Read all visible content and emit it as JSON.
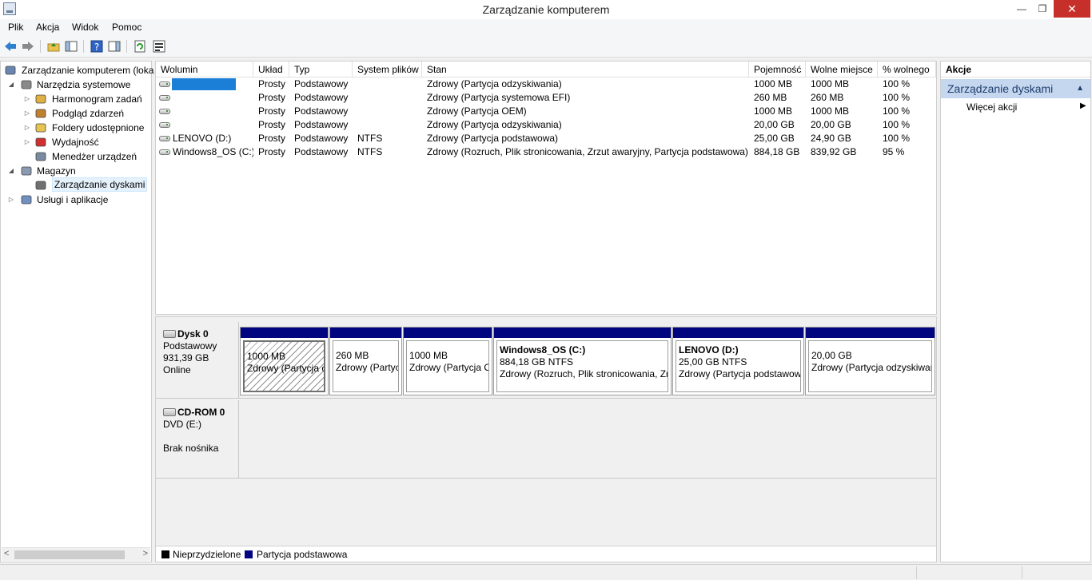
{
  "window": {
    "title": "Zarządzanie komputerem",
    "min": "—",
    "max": "❐",
    "close": "✕"
  },
  "menu": [
    "Plik",
    "Akcja",
    "Widok",
    "Pomoc"
  ],
  "tree": [
    {
      "label": "Zarządzanie komputerem (loka",
      "level": 0,
      "arrow": "",
      "icon": "computer-management-icon"
    },
    {
      "label": "Narzędzia systemowe",
      "level": 1,
      "arrow": "◢",
      "icon": "system-tools-icon"
    },
    {
      "label": "Harmonogram zadań",
      "level": 2,
      "arrow": "▷",
      "icon": "task-scheduler-icon"
    },
    {
      "label": "Podgląd zdarzeń",
      "level": 2,
      "arrow": "▷",
      "icon": "event-viewer-icon"
    },
    {
      "label": "Foldery udostępnione",
      "level": 2,
      "arrow": "▷",
      "icon": "shared-folders-icon"
    },
    {
      "label": "Wydajność",
      "level": 2,
      "arrow": "▷",
      "icon": "performance-icon"
    },
    {
      "label": "Menedżer urządzeń",
      "level": 2,
      "arrow": "",
      "icon": "device-manager-icon"
    },
    {
      "label": "Magazyn",
      "level": 1,
      "arrow": "◢",
      "icon": "storage-icon"
    },
    {
      "label": "Zarządzanie dyskami",
      "level": 2,
      "arrow": "",
      "icon": "disk-management-icon",
      "selected": true
    },
    {
      "label": "Usługi i aplikacje",
      "level": 1,
      "arrow": "▷",
      "icon": "services-apps-icon"
    }
  ],
  "volumes": {
    "headers": [
      "Wolumin",
      "Układ",
      "Typ",
      "System plików",
      "Stan",
      "Pojemność",
      "Wolne miejsce",
      "% wolnego"
    ],
    "rows": [
      {
        "name": "",
        "layout": "Prosty",
        "type": "Podstawowy",
        "fs": "",
        "status": "Zdrowy (Partycja odzyskiwania)",
        "capacity": "1000 MB",
        "free": "1000 MB",
        "pct": "100 %",
        "selected": true
      },
      {
        "name": "",
        "layout": "Prosty",
        "type": "Podstawowy",
        "fs": "",
        "status": "Zdrowy (Partycja systemowa EFI)",
        "capacity": "260 MB",
        "free": "260 MB",
        "pct": "100 %"
      },
      {
        "name": "",
        "layout": "Prosty",
        "type": "Podstawowy",
        "fs": "",
        "status": "Zdrowy (Partycja OEM)",
        "capacity": "1000 MB",
        "free": "1000 MB",
        "pct": "100 %"
      },
      {
        "name": "",
        "layout": "Prosty",
        "type": "Podstawowy",
        "fs": "",
        "status": "Zdrowy (Partycja odzyskiwania)",
        "capacity": "20,00 GB",
        "free": "20,00 GB",
        "pct": "100 %"
      },
      {
        "name": "LENOVO (D:)",
        "layout": "Prosty",
        "type": "Podstawowy",
        "fs": "NTFS",
        "status": "Zdrowy (Partycja podstawowa)",
        "capacity": "25,00 GB",
        "free": "24,90 GB",
        "pct": "100 %"
      },
      {
        "name": "Windows8_OS (C:)",
        "layout": "Prosty",
        "type": "Podstawowy",
        "fs": "NTFS",
        "status": "Zdrowy (Rozruch, Plik stronicowania, Zrzut awaryjny, Partycja podstawowa)",
        "capacity": "884,18 GB",
        "free": "839,92 GB",
        "pct": "95 %"
      }
    ]
  },
  "disk0": {
    "name": "Dysk 0",
    "type": "Podstawowy",
    "size": "931,39 GB",
    "state": "Online",
    "partitions": [
      {
        "title": "",
        "size": "1000 MB",
        "status": "Zdrowy (Partycja odzyskiwania)",
        "selected": true
      },
      {
        "title": "",
        "size": "260 MB",
        "status": "Zdrowy (Partycja systemowa EFI)"
      },
      {
        "title": "",
        "size": "1000 MB",
        "status": "Zdrowy (Partycja OEM)"
      },
      {
        "title": "Windows8_OS  (C:)",
        "size": "884,18 GB NTFS",
        "status": "Zdrowy (Rozruch, Plik stronicowania, Zrzut awaryjny, Partycja podstawowa)"
      },
      {
        "title": "LENOVO  (D:)",
        "size": "25,00 GB NTFS",
        "status": "Zdrowy (Partycja podstawowa)"
      },
      {
        "title": "",
        "size": "20,00 GB",
        "status": "Zdrowy (Partycja odzyskiwania)"
      }
    ]
  },
  "cdrom": {
    "name": "CD-ROM 0",
    "type": "DVD (E:)",
    "state": "Brak nośnika"
  },
  "legend": [
    {
      "label": "Nieprzydzielone",
      "color": "#000000"
    },
    {
      "label": "Partycja podstawowa",
      "color": "#020580"
    }
  ],
  "actions": {
    "header": "Akcje",
    "section": "Zarządzanie dyskami",
    "item": "Więcej akcji"
  },
  "colors": {
    "partition_cap": "#020580",
    "selection": "#1b7fd8",
    "close_button": "#c7302a"
  }
}
